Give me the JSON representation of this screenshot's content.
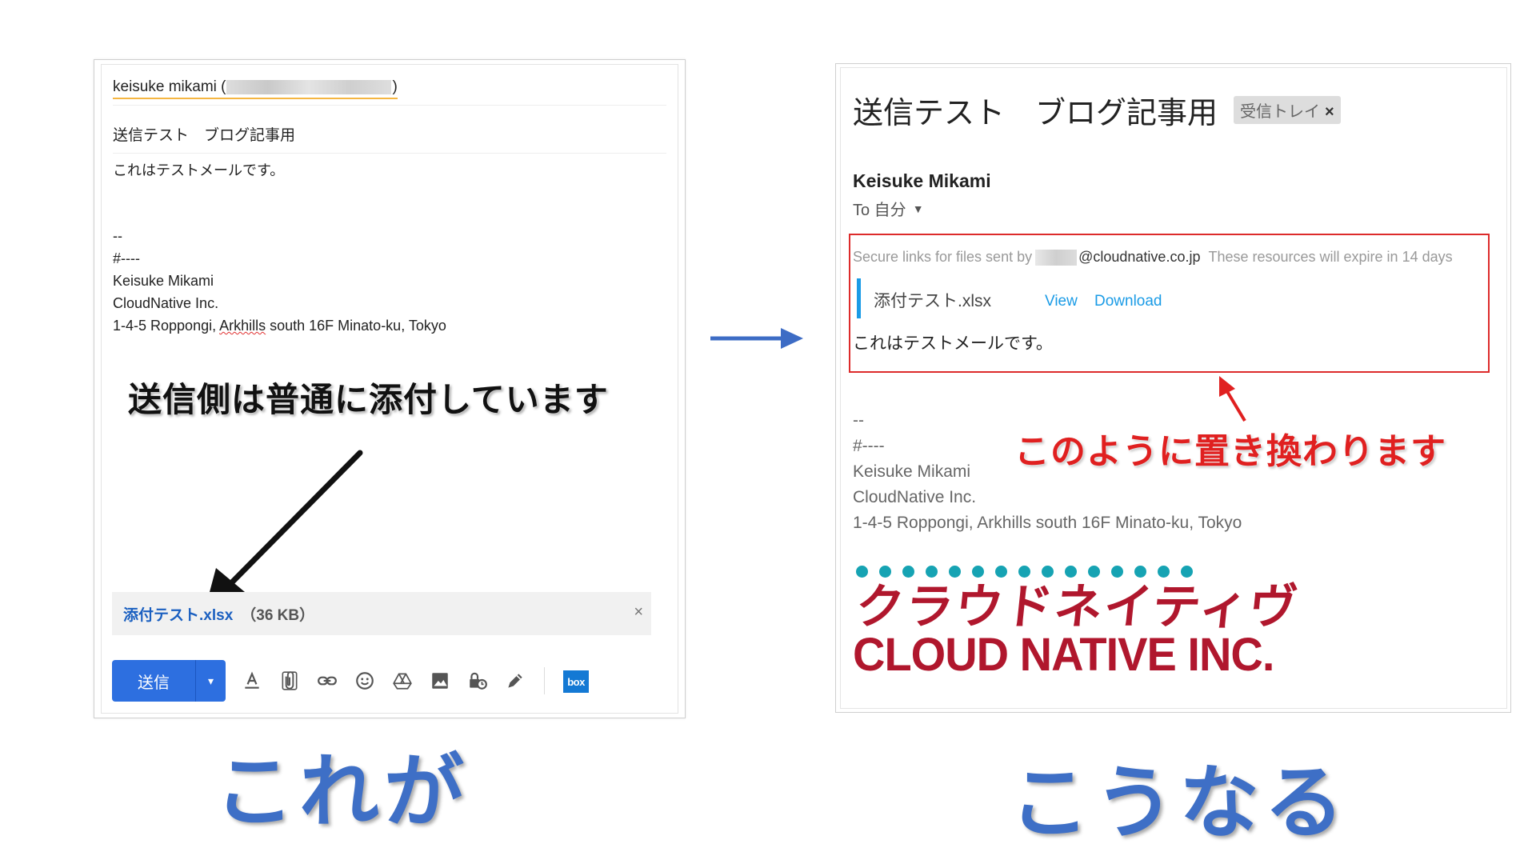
{
  "compose": {
    "to_name": "keisuke mikami (",
    "to_close": ")",
    "subject": "送信テスト　ブログ記事用",
    "body": "これはテストメールです。",
    "signature": [
      "--",
      "#----",
      "Keisuke Mikami",
      "CloudNative Inc."
    ],
    "address_pre": "1-4-5 Roppongi, ",
    "address_squig": "Arkhills",
    "address_post": " south 16F Minato-ku, Tokyo",
    "attachment_name": "添付テスト.xlsx",
    "attachment_size": "（36 KB）",
    "attachment_remove": "×",
    "send_label": "送信",
    "send_caret": "▾",
    "toolbar_icons": [
      "format-text-icon",
      "attach-file-icon",
      "insert-link-icon",
      "emoji-icon",
      "google-drive-icon",
      "insert-photo-icon",
      "confidential-mode-icon",
      "signature-pen-icon",
      "box-icon"
    ],
    "box_label": "box"
  },
  "annotations": {
    "left_callout": "送信側は普通に添付しています",
    "right_callout": "このように置き換わります",
    "caption_left": "これが",
    "caption_right": "こうなる"
  },
  "received": {
    "subject": "送信テスト　ブログ記事用",
    "label": "受信トレイ",
    "label_close": "×",
    "sender": "Keisuke Mikami",
    "to": "To 自分",
    "to_caret": "▼",
    "secure_prefix": "Secure links for files sent by",
    "secure_domain": "@cloudnative.co.jp",
    "secure_expiry": "These resources will expire in 14 days",
    "file_name": "添付テスト.xlsx",
    "view": "View",
    "download": "Download",
    "body": "これはテストメールです。",
    "signature": [
      "--",
      "#----",
      "Keisuke Mikami",
      "CloudNative Inc.",
      "1-4-5 Roppongi, Arkhills south 16F Minato-ku, Tokyo"
    ],
    "logo_jp": "クラウドネイティヴ",
    "logo_en": "CLOUD NATIVE INC."
  },
  "colors": {
    "send_blue": "#2d6fe0",
    "link_blue": "#1a9be6",
    "callout_red": "#e02020",
    "caption_blue": "#3e6fc6",
    "logo_red": "#b0172d",
    "logo_teal": "#16a3b3"
  }
}
